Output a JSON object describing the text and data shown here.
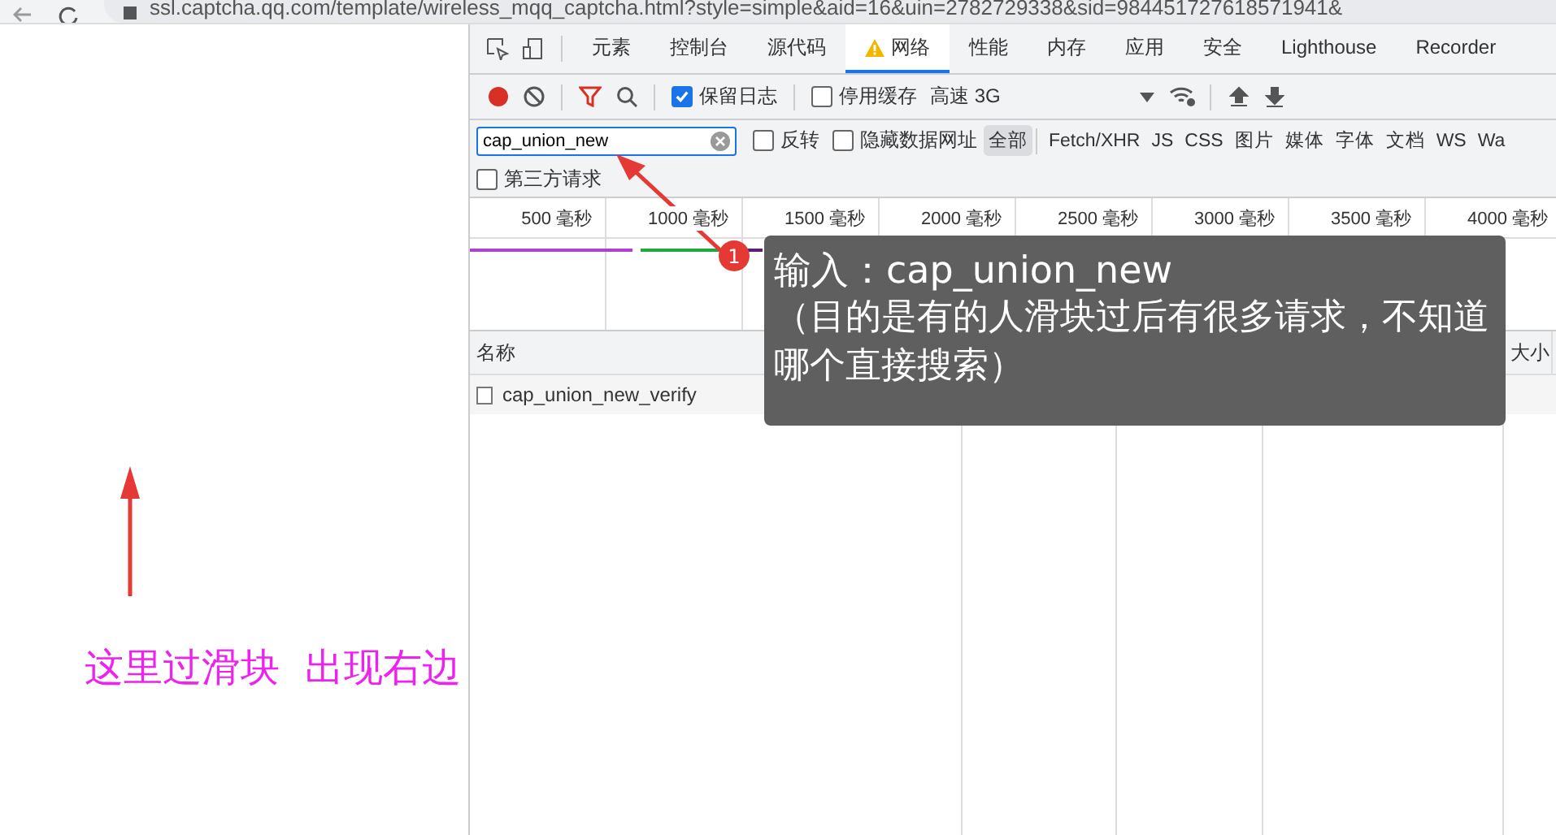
{
  "address_bar": {
    "url": "ssl.captcha.qq.com/template/wireless_mqq_captcha.html?style=simple&aid=16&uin=2782729338&sid=984451727618571941&"
  },
  "devtools": {
    "tabs": [
      {
        "label": "元素",
        "selected": false
      },
      {
        "label": "控制台",
        "selected": false
      },
      {
        "label": "源代码",
        "selected": false
      },
      {
        "label": "网络",
        "selected": true,
        "warning": true
      },
      {
        "label": "性能",
        "selected": false
      },
      {
        "label": "内存",
        "selected": false
      },
      {
        "label": "应用",
        "selected": false
      },
      {
        "label": "安全",
        "selected": false
      },
      {
        "label": "Lighthouse",
        "selected": false
      },
      {
        "label": "Recorder",
        "selected": false
      }
    ],
    "toolbar": {
      "recording": true,
      "preserve_log": {
        "label": "保留日志",
        "checked": true
      },
      "disable_cache": {
        "label": "停用缓存",
        "checked": false
      },
      "throttling": "高速 3G"
    },
    "filter": {
      "value": "cap_union_new",
      "invert": {
        "label": "反转",
        "checked": false
      },
      "hide_data_urls": {
        "label": "隐藏数据网址",
        "checked": false
      },
      "types": [
        {
          "label": "全部",
          "selected": true
        },
        {
          "label": "Fetch/XHR",
          "selected": false
        },
        {
          "label": "JS",
          "selected": false
        },
        {
          "label": "CSS",
          "selected": false
        },
        {
          "label": "图片",
          "selected": false
        },
        {
          "label": "媒体",
          "selected": false
        },
        {
          "label": "字体",
          "selected": false
        },
        {
          "label": "文档",
          "selected": false
        },
        {
          "label": "WS",
          "selected": false
        },
        {
          "label": "Wa",
          "selected": false
        }
      ],
      "third_party": {
        "label": "第三方请求",
        "checked": false
      }
    },
    "timeline": {
      "ticks": [
        "500 毫秒",
        "1000 毫秒",
        "1500 毫秒",
        "2000 毫秒",
        "2500 毫秒",
        "3000 毫秒",
        "3500 毫秒",
        "4000 毫秒"
      ]
    },
    "table": {
      "columns": [
        "名称",
        "大小"
      ],
      "rows": [
        {
          "name": "cap_union_new_verify"
        }
      ]
    }
  },
  "annotations": {
    "badge": "1",
    "callout": "输入：cap_union_new",
    "callout_note": "（目的是有的人滑块过后有很多请求，不知道哪个直接搜索）",
    "left_note": "这里过滑块  出现右边"
  }
}
